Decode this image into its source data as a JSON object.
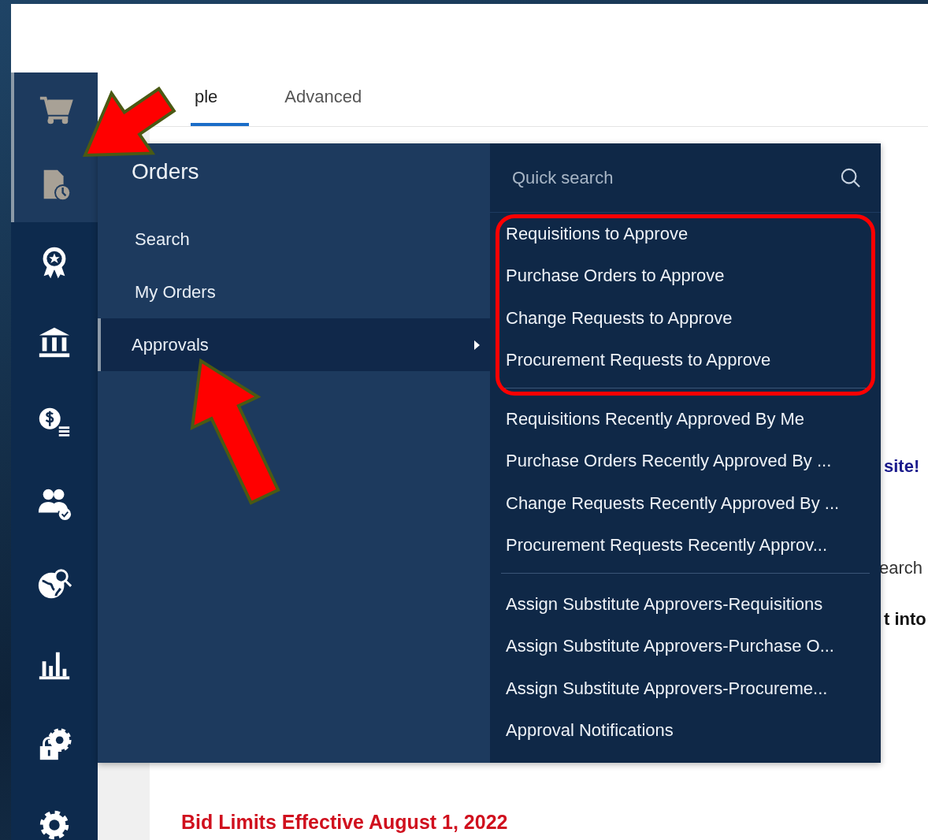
{
  "rail": {
    "items": [
      {
        "kind": "cart",
        "highlighted": true
      },
      {
        "kind": "orders",
        "highlighted": true
      },
      {
        "kind": "award",
        "highlighted": false
      },
      {
        "kind": "bank",
        "highlighted": false
      },
      {
        "kind": "money",
        "highlighted": false
      },
      {
        "kind": "users",
        "highlighted": false
      },
      {
        "kind": "globe",
        "highlighted": false
      },
      {
        "kind": "chart",
        "highlighted": false
      },
      {
        "kind": "lock-gear",
        "highlighted": false
      },
      {
        "kind": "gear",
        "highlighted": false
      }
    ]
  },
  "tabs": [
    {
      "label": "ple",
      "selected": true
    },
    {
      "label": "Advanced",
      "selected": false
    }
  ],
  "menu": {
    "title": "Orders",
    "items": [
      {
        "label": "Search",
        "selected": false,
        "has_submenu": false
      },
      {
        "label": "My Orders",
        "selected": false,
        "has_submenu": false
      },
      {
        "label": "Approvals",
        "selected": true,
        "has_submenu": true
      }
    ]
  },
  "submenu": {
    "search": {
      "placeholder": "Quick search"
    },
    "groups": [
      [
        "Requisitions to Approve",
        "Purchase Orders to Approve",
        "Change Requests to Approve",
        "Procurement Requests to Approve"
      ],
      [
        "Requisitions Recently Approved By Me",
        "Purchase Orders Recently Approved By ...",
        "Change Requests Recently Approved By ...",
        "Procurement Requests Recently Approv..."
      ],
      [
        "Assign Substitute Approvers-Requisitions",
        "Assign Substitute Approvers-Purchase O...",
        "Assign Substitute Approvers-Procureme...",
        "Approval Notifications"
      ]
    ]
  },
  "page": {
    "welcome_fragment": "site!",
    "search_fragment": "earch",
    "bold_fragment": "t into",
    "notice_title": "Bid Limits Effective August 1, 2022"
  }
}
